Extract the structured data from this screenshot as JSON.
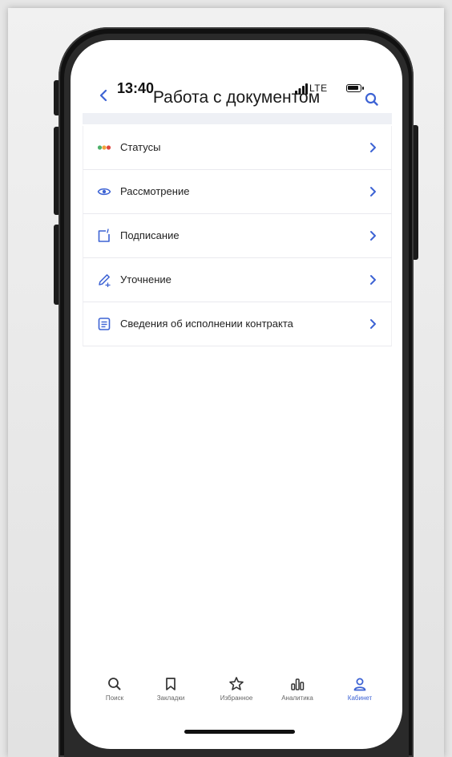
{
  "status_bar": {
    "time": "13:40",
    "network": "LTE"
  },
  "header": {
    "title": "Работа с документом"
  },
  "menu": {
    "items": [
      {
        "label": "Статусы",
        "icon": "status-dots-icon"
      },
      {
        "label": "Рассмотрение",
        "icon": "eye-icon"
      },
      {
        "label": "Подписание",
        "icon": "sign-document-icon"
      },
      {
        "label": "Уточнение",
        "icon": "pencil-icon"
      },
      {
        "label": "Сведения об исполнении контракта",
        "icon": "document-list-icon"
      }
    ]
  },
  "tabbar": {
    "tabs": [
      {
        "label": "Поиск",
        "icon": "search-icon"
      },
      {
        "label": "Закладки",
        "icon": "bookmark-icon"
      },
      {
        "label": "Избранное",
        "icon": "star-icon"
      },
      {
        "label": "Аналитика",
        "icon": "analytics-icon"
      },
      {
        "label": "Кабинет",
        "icon": "profile-icon"
      }
    ],
    "active": "Кабинет"
  },
  "colors": {
    "accent": "#3d63d4",
    "dot_red": "#e0483e",
    "dot_orange": "#f0a33a",
    "dot_green": "#4db06a"
  }
}
